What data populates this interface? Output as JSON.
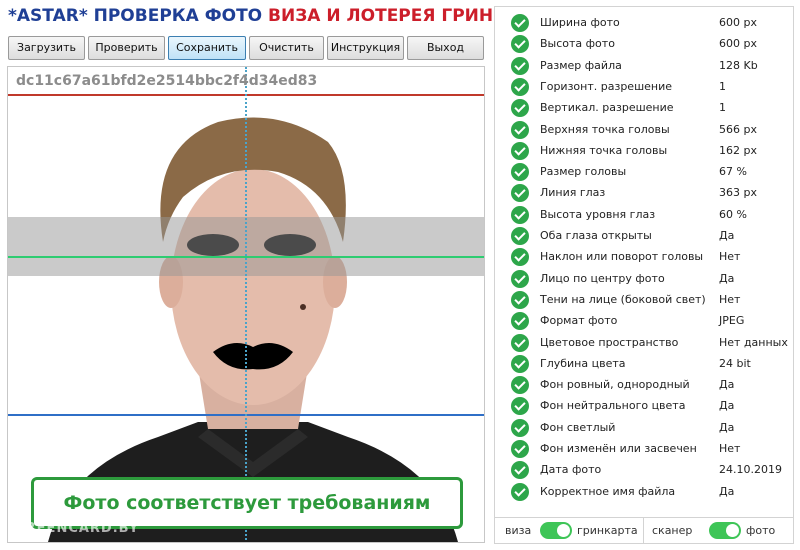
{
  "header": {
    "title_part1": "*ASTAR* ПРОВЕРКА ФОТО",
    "title_part2": "ВИЗА И ЛОТЕРЕЯ ГРИН КАРТА"
  },
  "toolbar": {
    "buttons": [
      {
        "label": "Загрузить"
      },
      {
        "label": "Проверить"
      },
      {
        "label": "Сохранить"
      },
      {
        "label": "Очистить"
      },
      {
        "label": "Инструкция"
      },
      {
        "label": "Выход"
      }
    ]
  },
  "photo": {
    "hash": "dc11c67a61bfd2e2514bbc2f4d34ed83",
    "status_message": "Фото соответствует требованиям",
    "watermark": "GREENCARD.BY",
    "line_colors": {
      "top": "#c0392b",
      "eyes": "#2ecc71",
      "chin": "#2f6fc7",
      "center": "#4aa3c9"
    }
  },
  "checks": [
    {
      "label": "Ширина фото",
      "value": "600 px"
    },
    {
      "label": "Высота фото",
      "value": "600 px"
    },
    {
      "label": "Размер файла",
      "value": "128 Kb"
    },
    {
      "label": "Горизонт. разрешение",
      "value": "1"
    },
    {
      "label": "Вертикал. разрешение",
      "value": "1"
    },
    {
      "label": "Верхняя точка головы",
      "value": "566 px"
    },
    {
      "label": "Нижняя точка головы",
      "value": "162 px"
    },
    {
      "label": "Размер головы",
      "value": "67 %"
    },
    {
      "label": "Линия глаз",
      "value": "363 px"
    },
    {
      "label": "Высота уровня глаз",
      "value": "60 %"
    },
    {
      "label": "Оба глаза открыты",
      "value": "Да"
    },
    {
      "label": "Наклон или поворот головы",
      "value": "Нет"
    },
    {
      "label": "Лицо по центру фото",
      "value": "Да"
    },
    {
      "label": "Тени на лице (боковой свет)",
      "value": "Нет"
    },
    {
      "label": "Формат фото",
      "value": "JPEG"
    },
    {
      "label": "Цветовое пространство",
      "value": "Нет данных"
    },
    {
      "label": "Глубина цвета",
      "value": "24 bit"
    },
    {
      "label": "Фон ровный, однородный",
      "value": "Да"
    },
    {
      "label": "Фон нейтрального цвета",
      "value": "Да"
    },
    {
      "label": "Фон светлый",
      "value": "Да"
    },
    {
      "label": "Фон изменён или засвечен",
      "value": "Нет"
    },
    {
      "label": "Дата фото",
      "value": "24.10.2019"
    },
    {
      "label": "Корректное имя файла",
      "value": "Да"
    }
  ],
  "toggles": {
    "mode": {
      "left_label": "виза",
      "right_label": "гринкарта",
      "state": "гринкарта"
    },
    "source": {
      "left_label": "сканер",
      "right_label": "фото",
      "state": "фото"
    }
  },
  "colors": {
    "check_green": "#2da64a",
    "switch_green": "#3ec557",
    "title_blue": "#1f3f95",
    "title_red": "#cc1e2a",
    "status_green": "#2d9a3c"
  }
}
